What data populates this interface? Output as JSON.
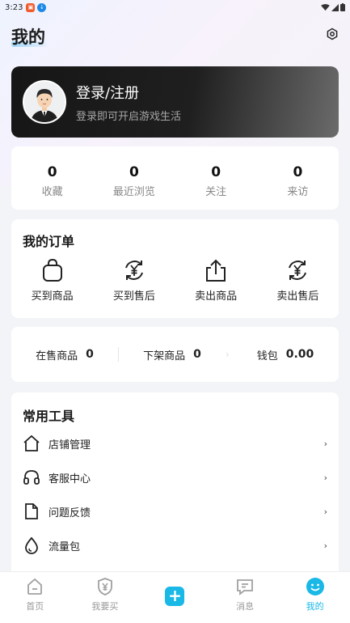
{
  "status_bar": {
    "time": "3:23"
  },
  "header": {
    "title": "我的"
  },
  "login": {
    "title": "登录/注册",
    "subtitle": "登录即可开启游戏生活"
  },
  "stats": [
    {
      "value": "0",
      "label": "收藏"
    },
    {
      "value": "0",
      "label": "最近浏览"
    },
    {
      "value": "0",
      "label": "关注"
    },
    {
      "value": "0",
      "label": "来访"
    }
  ],
  "orders": {
    "title": "我的订单",
    "items": [
      {
        "label": "买到商品",
        "icon": "shopping-bag-icon"
      },
      {
        "label": "买到售后",
        "icon": "yuan-refresh-icon"
      },
      {
        "label": "卖出商品",
        "icon": "upload-icon"
      },
      {
        "label": "卖出售后",
        "icon": "yuan-refresh-icon"
      }
    ]
  },
  "wallet": {
    "on_sale_label": "在售商品",
    "on_sale_value": "0",
    "off_shelf_label": "下架商品",
    "off_shelf_value": "0",
    "wallet_label": "钱包",
    "wallet_value": "0.00"
  },
  "tools": {
    "title": "常用工具",
    "items": [
      {
        "label": "店铺管理",
        "icon": "house-icon"
      },
      {
        "label": "客服中心",
        "icon": "headset-icon"
      },
      {
        "label": "问题反馈",
        "icon": "document-icon"
      },
      {
        "label": "流量包",
        "icon": "droplet-icon"
      }
    ]
  },
  "tabbar": {
    "items": [
      {
        "label": "首页",
        "icon": "home-icon"
      },
      {
        "label": "我要买",
        "icon": "yuan-shield-icon"
      },
      {
        "label": "",
        "icon": "add-icon"
      },
      {
        "label": "消息",
        "icon": "message-icon"
      },
      {
        "label": "我的",
        "icon": "smiley-icon"
      }
    ]
  },
  "colors": {
    "accent": "#1ab8e6",
    "card_dark": "#161616"
  }
}
